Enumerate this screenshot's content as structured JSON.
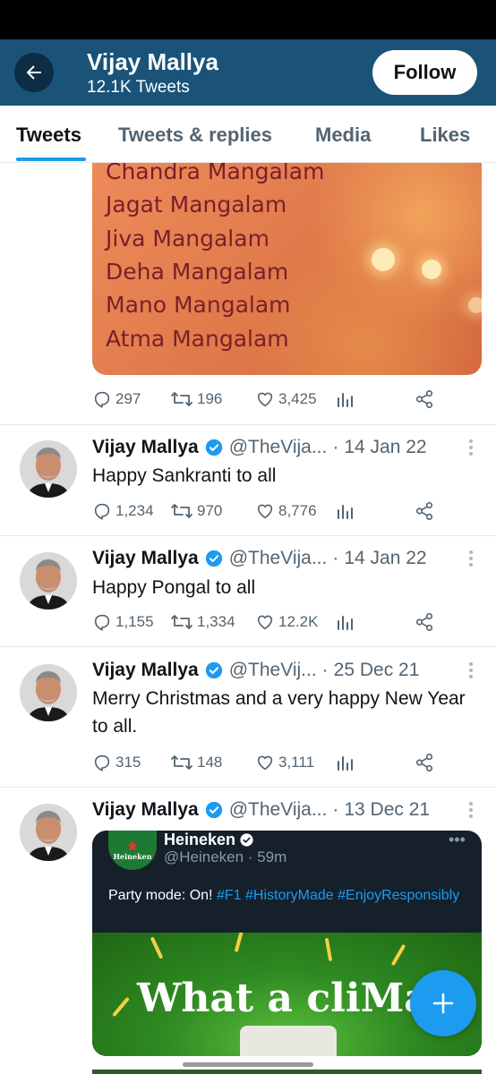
{
  "header": {
    "name": "Vijay Mallya",
    "tweet_count": "12.1K Tweets",
    "follow_label": "Follow",
    "colors": {
      "bar": "#1b5378",
      "accent": "#1d9bf0"
    }
  },
  "tabs": [
    {
      "label": "Tweets",
      "active": true
    },
    {
      "label": "Tweets & replies"
    },
    {
      "label": "Media"
    },
    {
      "label": "Likes"
    }
  ],
  "blessing": {
    "lines": [
      "Chandra Mangalam",
      "Jagat Mangalam",
      "Jiva Mangalam",
      "Deha Mangalam",
      "Mano Mangalam",
      "Atma Mangalam"
    ],
    "actions": {
      "replies": "297",
      "retweets": "196",
      "likes": "3,425"
    }
  },
  "tweets": [
    {
      "name": "Vijay Mallya",
      "handle": "@TheVija...",
      "date": "14 Jan 22",
      "text": "Happy Sankranti to all",
      "replies": "1,234",
      "retweets": "970",
      "likes": "8,776"
    },
    {
      "name": "Vijay Mallya",
      "handle": "@TheVija...",
      "date": "14 Jan 22",
      "text": "Happy Pongal to all",
      "replies": "1,155",
      "retweets": "1,334",
      "likes": "12.2K"
    },
    {
      "name": "Vijay Mallya",
      "handle": "@TheVij...",
      "date": "25 Dec 21",
      "text": "Merry Christmas and a very happy New Year to all.",
      "replies": "315",
      "retweets": "148",
      "likes": "3,111"
    },
    {
      "name": "Vijay Mallya",
      "handle": "@TheVija...",
      "date": "13 Dec 21"
    }
  ],
  "quote": {
    "name": "Heineken",
    "handle": "@Heineken · 59m",
    "logo_text": "Heineken",
    "text": "Party mode: On!",
    "tags": [
      "#F1",
      "#HistoryMade",
      "#EnjoyResponsibly"
    ],
    "image_text": "What a cliMax",
    "more": "•••"
  },
  "icons": {
    "back": "arrow-left-icon",
    "reply": "reply-icon",
    "retweet": "retweet-icon",
    "like": "heart-icon",
    "analytics": "bar-chart-icon",
    "share": "share-icon",
    "verified": "verified-badge-icon",
    "compose": "plus-icon"
  }
}
